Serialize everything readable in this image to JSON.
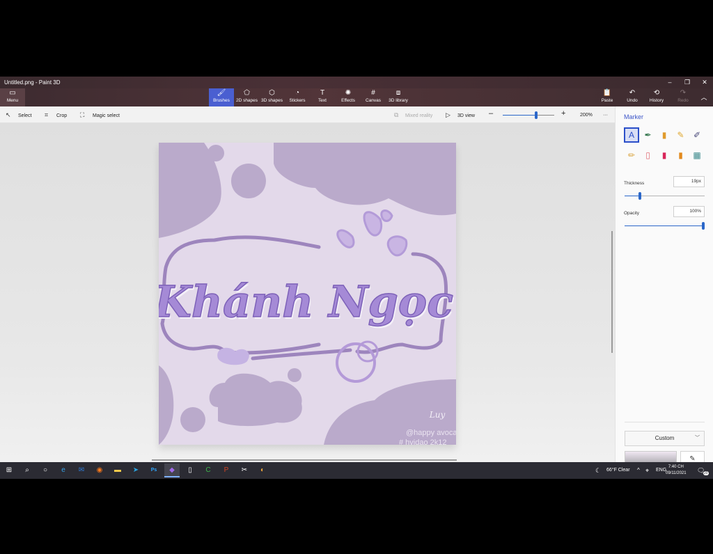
{
  "window": {
    "title": "Untitled.png - Paint 3D",
    "minimize_icon": "minimize-icon",
    "restore_icon": "restore-icon",
    "close_icon": "close-icon"
  },
  "ribbon": {
    "menu_label": "Menu",
    "tools": [
      {
        "label": "Brushes",
        "icon": "brush-icon"
      },
      {
        "label": "2D shapes",
        "icon": "2d-shapes-icon"
      },
      {
        "label": "3D shapes",
        "icon": "3d-shapes-icon"
      },
      {
        "label": "Stickers",
        "icon": "stickers-icon"
      },
      {
        "label": "Text",
        "icon": "text-icon"
      },
      {
        "label": "Effects",
        "icon": "effects-icon"
      },
      {
        "label": "Canvas",
        "icon": "canvas-icon"
      },
      {
        "label": "3D library",
        "icon": "3d-library-icon"
      }
    ],
    "active_tool": "Brushes",
    "actions": [
      {
        "label": "Paste",
        "icon": "paste-icon"
      },
      {
        "label": "Undo",
        "icon": "undo-icon"
      },
      {
        "label": "History",
        "icon": "history-icon"
      },
      {
        "label": "Redo",
        "icon": "redo-icon"
      }
    ]
  },
  "toolbar": {
    "select": "Select",
    "crop": "Crop",
    "magic_select": "Magic select",
    "mixed_reality": "Mixed reality",
    "view_3d": "3D view",
    "zoom": "200%",
    "zoom_level": 0.65,
    "more_icon": "more-icon"
  },
  "canvas": {
    "text": "Khánh Ngọc",
    "signature": "Luy",
    "watermark_1": "@happy avoca",
    "watermark_2": "# hvidao 2k12",
    "colors": {
      "background": "#e3d9ea",
      "blob": "#baaacb",
      "frame": "#9d85bd",
      "lettering": "#a58ad6"
    }
  },
  "panel": {
    "title": "Marker",
    "brushes": [
      {
        "name": "marker",
        "icon": "marker-icon",
        "color": "#2b4fc9"
      },
      {
        "name": "calligraphy-pen",
        "icon": "calligraphy-pen-icon",
        "color": "#3a7a52"
      },
      {
        "name": "oil-brush",
        "icon": "oil-brush-icon",
        "color": "#e09b2d"
      },
      {
        "name": "watercolor",
        "icon": "watercolor-icon",
        "color": "#e0a72d"
      },
      {
        "name": "pixel-pen",
        "icon": "pixel-pen-icon",
        "color": "#4a4a7a"
      },
      {
        "name": "pencil",
        "icon": "pencil-icon",
        "color": "#d9a33c"
      },
      {
        "name": "eraser",
        "icon": "eraser-icon",
        "color": "#e06b74"
      },
      {
        "name": "crayon",
        "icon": "crayon-icon",
        "color": "#d8265a"
      },
      {
        "name": "spray-can",
        "icon": "spray-can-icon",
        "color": "#e28a1e"
      },
      {
        "name": "fill",
        "icon": "fill-icon",
        "color": "#3b8a8c"
      }
    ],
    "thickness_label": "Thickness",
    "thickness_value": "19px",
    "thickness_level": 0.19,
    "opacity_label": "Opacity",
    "opacity_value": "100%",
    "opacity_level": 1.0,
    "color_mode": "Custom",
    "eyedropper_icon": "eyedropper-icon",
    "palette": [
      "#ffffff",
      "#c0c0c0",
      "#555555",
      "#111111",
      "#7a0a1c",
      "#e01f24",
      "#ff8a14",
      "#ffc20e",
      "#fde9a4",
      "#ffe500",
      "#b5e61d",
      "#3ec63e",
      "#8ff0ff",
      "#1e9eff",
      "#3f4fd6",
      "#b44dc9",
      "#f7b6c8",
      "#b98055",
      "#f4b183",
      "#6d4027",
      "#34434f",
      "#1b1b1b",
      "#93d173",
      "#4c9a2a"
    ]
  },
  "taskbar": {
    "apps": [
      {
        "name": "start",
        "icon": "windows-icon",
        "color": "#ffffff"
      },
      {
        "name": "search",
        "icon": "search-icon",
        "color": "#ffffff"
      },
      {
        "name": "cortana",
        "icon": "cortana-icon",
        "color": "#ffffff"
      },
      {
        "name": "edge",
        "icon": "edge-icon",
        "color": "#35a2e8"
      },
      {
        "name": "mail",
        "icon": "mail-icon",
        "color": "#2d7bd8"
      },
      {
        "name": "firefox",
        "icon": "firefox-icon",
        "color": "#ff7a1a"
      },
      {
        "name": "file-explorer",
        "icon": "folder-icon",
        "color": "#f2c94c"
      },
      {
        "name": "telegram",
        "icon": "telegram-icon",
        "color": "#2aa3e0"
      },
      {
        "name": "photoshop",
        "icon": "photoshop-icon",
        "color": "#31a8ff"
      },
      {
        "name": "paint-3d",
        "icon": "paint-3d-icon",
        "color": "#a06ae8"
      },
      {
        "name": "notepad",
        "icon": "document-icon",
        "color": "#ffffff"
      },
      {
        "name": "camtasia",
        "icon": "camtasia-icon",
        "color": "#3cb44a"
      },
      {
        "name": "powerpoint",
        "icon": "powerpoint-icon",
        "color": "#d04423"
      },
      {
        "name": "snipping",
        "icon": "snip-icon",
        "color": "#ffffff"
      },
      {
        "name": "chrome",
        "icon": "chrome-icon",
        "color": "#e8a33c"
      }
    ],
    "weather_icon": "moon-icon",
    "weather_text": "66°F  Clear",
    "language": "ENG",
    "time": "7:40 CH",
    "date": "09/11/2021",
    "notifications_badge": "20"
  }
}
